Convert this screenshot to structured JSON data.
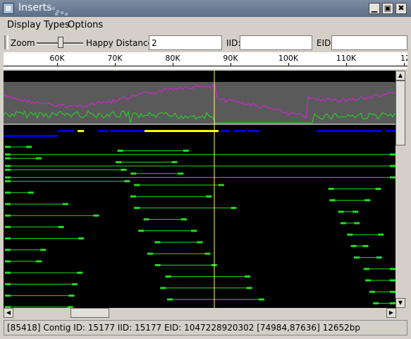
{
  "window": {
    "title": "Inserts",
    "icon": "window-icon"
  },
  "menu": [
    {
      "label": "Display Types",
      "mnemonic": "D"
    },
    {
      "label": "Options",
      "mnemonic": "O"
    }
  ],
  "toolbar": {
    "zoom_label": "Zoom",
    "happy_label": "Happy Distance:",
    "happy_value": "2",
    "iid_label": "IID:",
    "iid_value": "",
    "eid_label": "EID:",
    "eid_value": "",
    "zoom_level": 0.5
  },
  "ruler": {
    "ticks": [
      "60K",
      "70K",
      "80K",
      "90K",
      "100K",
      "110K",
      "12"
    ]
  },
  "status": {
    "text": "[85418] Contig ID: 15177 IID: 15177 EID: 1047228920302 [74984,87636] 12652bp"
  },
  "colors": {
    "coverage": "#e020e0",
    "happy": "#22dd22",
    "scaffold": "#0000dd",
    "highlight": "#ffff00",
    "cursor": "#ffff66"
  }
}
